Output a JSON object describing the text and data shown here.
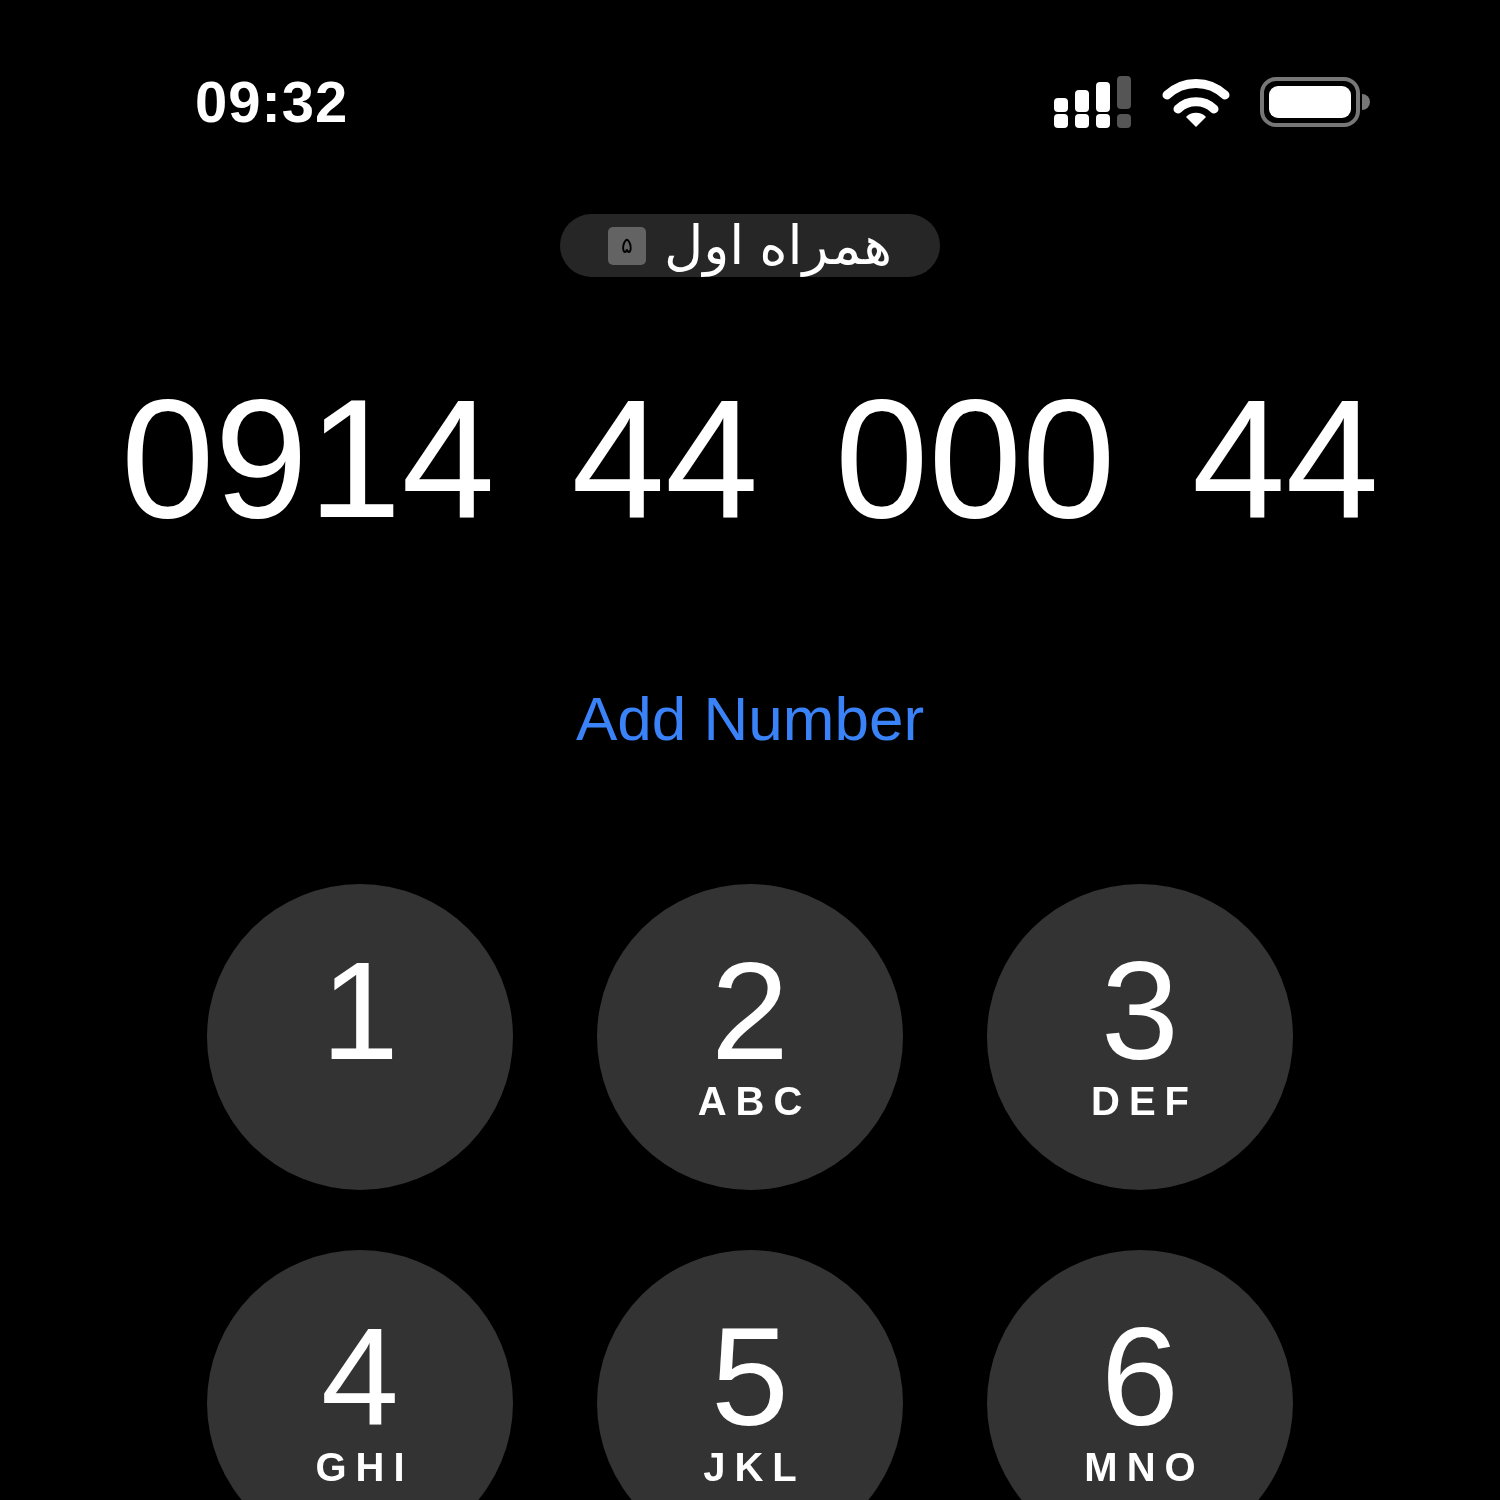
{
  "status_bar": {
    "time": "09:32"
  },
  "carrier": {
    "sim_label": "۵",
    "name": "همراه اول"
  },
  "dialed_number": "0914 44 000 44",
  "add_number": "Add Number",
  "keys": [
    {
      "digit": "1"
    },
    {
      "digit": "2",
      "letters": "ABC"
    },
    {
      "digit": "3",
      "letters": "DEF"
    },
    {
      "digit": "4",
      "letters": "GHI"
    },
    {
      "digit": "5",
      "letters": "JKL"
    },
    {
      "digit": "6",
      "letters": "MNO"
    }
  ]
}
